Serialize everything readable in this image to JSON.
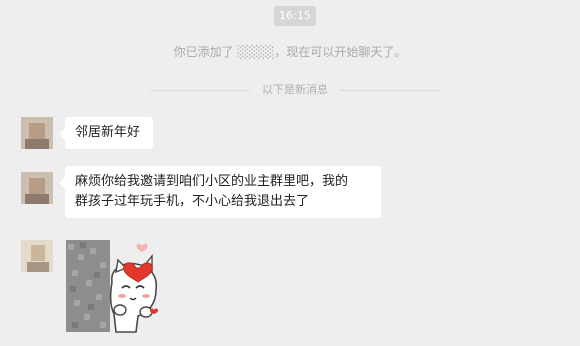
{
  "time_label": "16:15",
  "system_message": "你已添加了 ░░░░，现在可以开始聊天了。",
  "divider_label": "以下是新消息",
  "messages": [
    {
      "text": "邻居新年好"
    },
    {
      "line1": "麻烦你给我邀请到咱们小区的业主群里吧，我的",
      "line2": "群孩子过年玩手机，不小心给我退出去了"
    }
  ],
  "sticker_icon": "cartoon-cat-heart-sticker"
}
